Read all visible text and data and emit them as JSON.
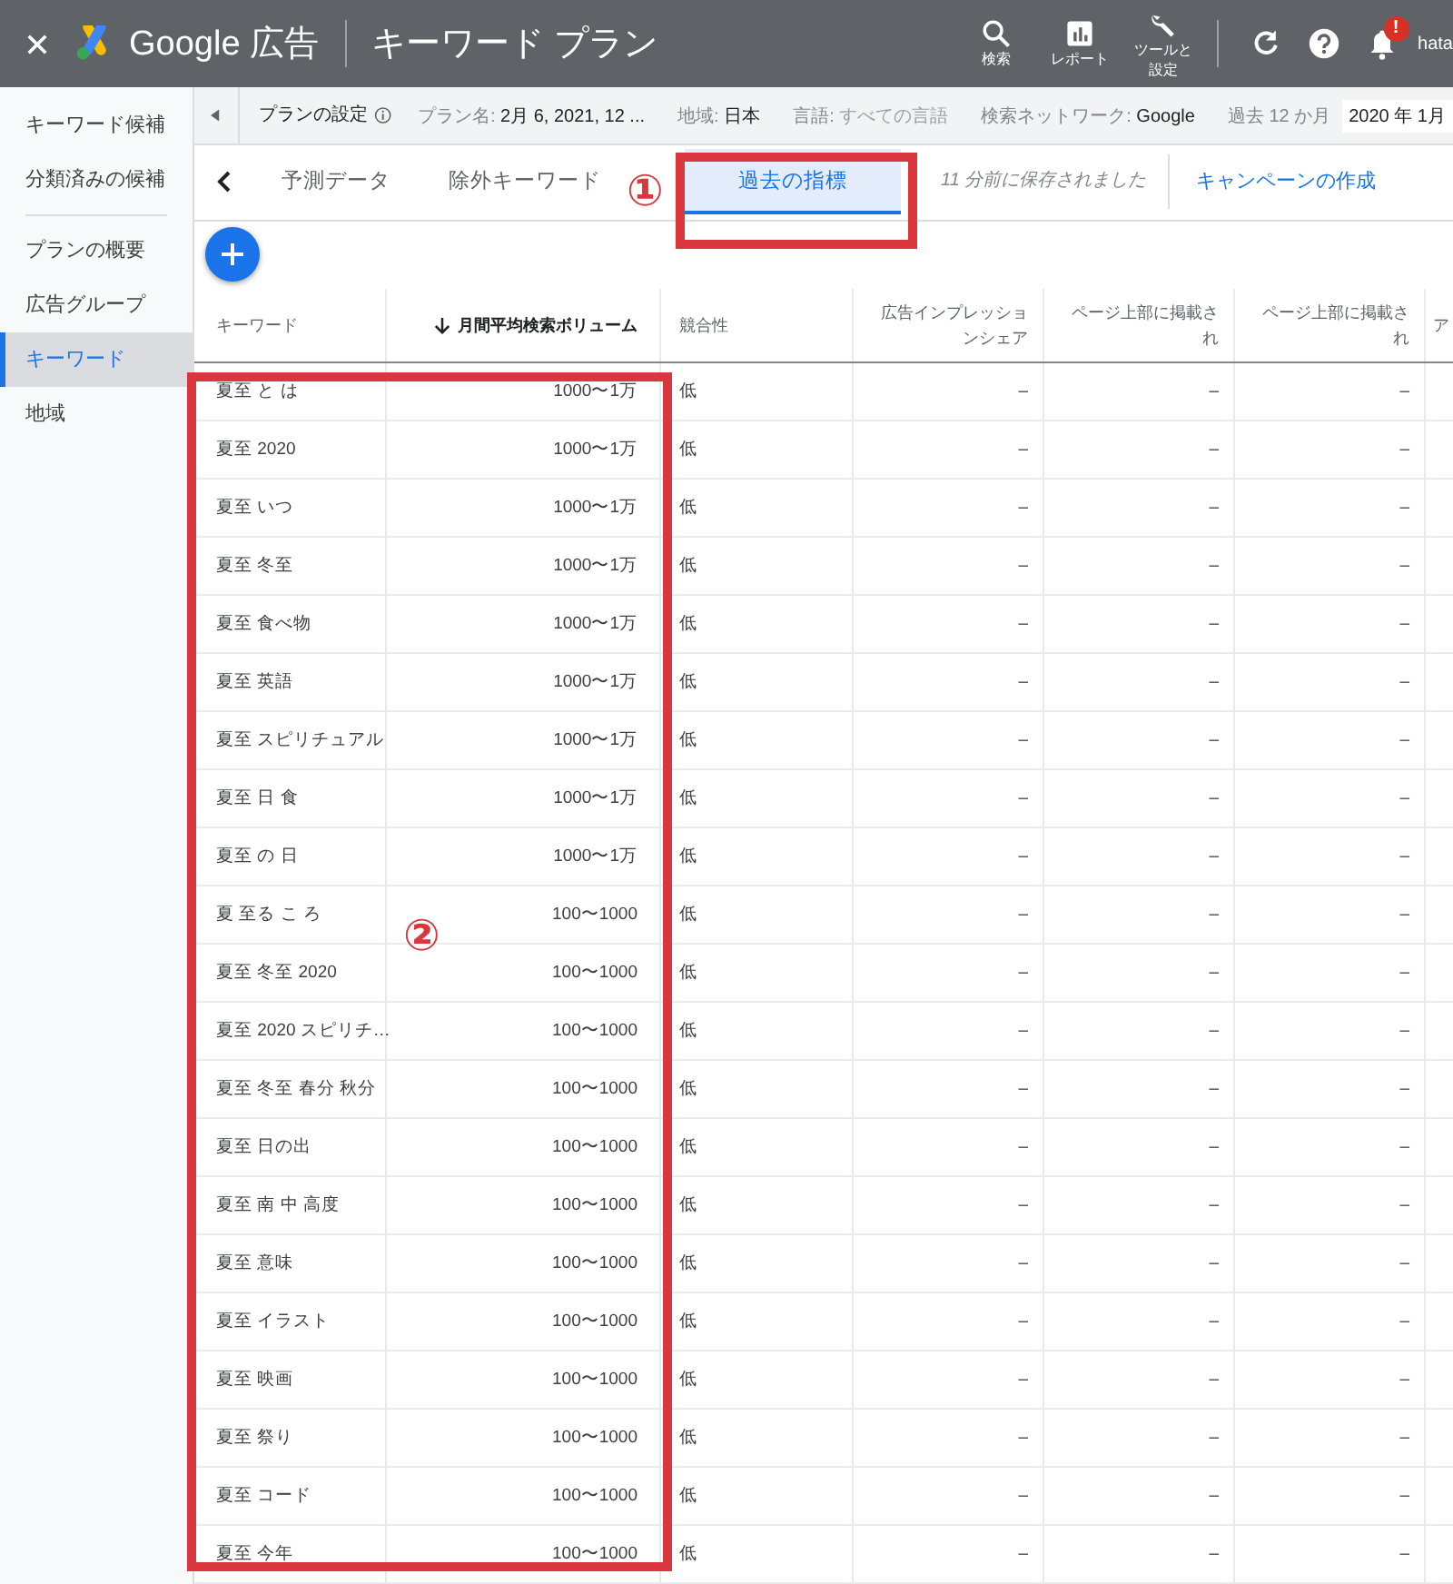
{
  "app": {
    "product": "Google 広告",
    "page_title": "キーワード プラン"
  },
  "toolbar": [
    {
      "kind": "search",
      "label": "検索"
    },
    {
      "kind": "report",
      "label": "レポート"
    },
    {
      "kind": "tools",
      "label": "ツールと設定"
    }
  ],
  "notification_badge": "!",
  "account": "hata",
  "plan_bar": {
    "title": "プランの設定",
    "fields": [
      {
        "label": "プラン名:",
        "value": "2月 6, 2021, 12 ...",
        "muted": false
      },
      {
        "label": "地域:",
        "value": "日本",
        "muted": false
      },
      {
        "label": "言語:",
        "value": "すべての言語",
        "muted": true
      },
      {
        "label": "検索ネットワーク:",
        "value": "Google",
        "muted": false
      }
    ],
    "period_label": "過去 12 か月",
    "period_value": "2020 年 1月"
  },
  "sidebar": {
    "groups": [
      {
        "items": [
          {
            "label": "キーワード候補",
            "selected": false
          },
          {
            "label": "分類済みの候補",
            "selected": false
          }
        ]
      },
      {
        "items": [
          {
            "label": "プランの概要",
            "selected": false
          },
          {
            "label": "広告グループ",
            "selected": false
          },
          {
            "label": "キーワード",
            "selected": true
          },
          {
            "label": "地域",
            "selected": false
          }
        ]
      }
    ]
  },
  "tabs": [
    {
      "label": "予測データ",
      "selected": false
    },
    {
      "label": "除外キーワード",
      "selected": false
    },
    {
      "label": "過去の指標",
      "selected": true
    }
  ],
  "saved_note": "11 分前に保存されました",
  "create_campaign": "キャンペーンの作成",
  "table": {
    "columns": [
      {
        "label": "キーワード",
        "sorted": false
      },
      {
        "label": "月間平均検索ボリューム",
        "sorted": true
      },
      {
        "label": "競合性",
        "sorted": false
      },
      {
        "label": "広告インプレッションシェア",
        "sorted": false
      },
      {
        "label": "ページ上部に掲載され",
        "sorted": false
      },
      {
        "label": "ページ上部に掲載され",
        "sorted": false
      },
      {
        "label": "ア",
        "sorted": false
      }
    ],
    "rows": [
      [
        "夏至 と は",
        "1000〜1万",
        "低",
        "–",
        "–",
        "–"
      ],
      [
        "夏至 2020",
        "1000〜1万",
        "低",
        "–",
        "–",
        "–"
      ],
      [
        "夏至 いつ",
        "1000〜1万",
        "低",
        "–",
        "–",
        "–"
      ],
      [
        "夏至 冬至",
        "1000〜1万",
        "低",
        "–",
        "–",
        "–"
      ],
      [
        "夏至 食べ物",
        "1000〜1万",
        "低",
        "–",
        "–",
        "–"
      ],
      [
        "夏至 英語",
        "1000〜1万",
        "低",
        "–",
        "–",
        "–"
      ],
      [
        "夏至 スピリチュアル",
        "1000〜1万",
        "低",
        "–",
        "–",
        "–"
      ],
      [
        "夏至 日 食",
        "1000〜1万",
        "低",
        "–",
        "–",
        "–"
      ],
      [
        "夏至 の 日",
        "1000〜1万",
        "低",
        "–",
        "–",
        "–"
      ],
      [
        "夏 至る こ ろ",
        "100〜1000",
        "低",
        "–",
        "–",
        "–"
      ],
      [
        "夏至 冬至 2020",
        "100〜1000",
        "低",
        "–",
        "–",
        "–"
      ],
      [
        "夏至 2020 スピリチ…",
        "100〜1000",
        "低",
        "–",
        "–",
        "–"
      ],
      [
        "夏至 冬至 春分 秋分",
        "100〜1000",
        "低",
        "–",
        "–",
        "–"
      ],
      [
        "夏至 日の出",
        "100〜1000",
        "低",
        "–",
        "–",
        "–"
      ],
      [
        "夏至 南 中 高度",
        "100〜1000",
        "低",
        "–",
        "–",
        "–"
      ],
      [
        "夏至 意味",
        "100〜1000",
        "低",
        "–",
        "–",
        "–"
      ],
      [
        "夏至 イラスト",
        "100〜1000",
        "低",
        "–",
        "–",
        "–"
      ],
      [
        "夏至 映画",
        "100〜1000",
        "低",
        "–",
        "–",
        "–"
      ],
      [
        "夏至 祭り",
        "100〜1000",
        "低",
        "–",
        "–",
        "–"
      ],
      [
        "夏至 コード",
        "100〜1000",
        "低",
        "–",
        "–",
        "–"
      ],
      [
        "夏至 今年",
        "100〜1000",
        "低",
        "–",
        "–",
        "–"
      ]
    ]
  },
  "annotations": [
    {
      "kind": "tab-highlight",
      "label": "①"
    },
    {
      "kind": "column-highlight",
      "label": "②"
    }
  ]
}
